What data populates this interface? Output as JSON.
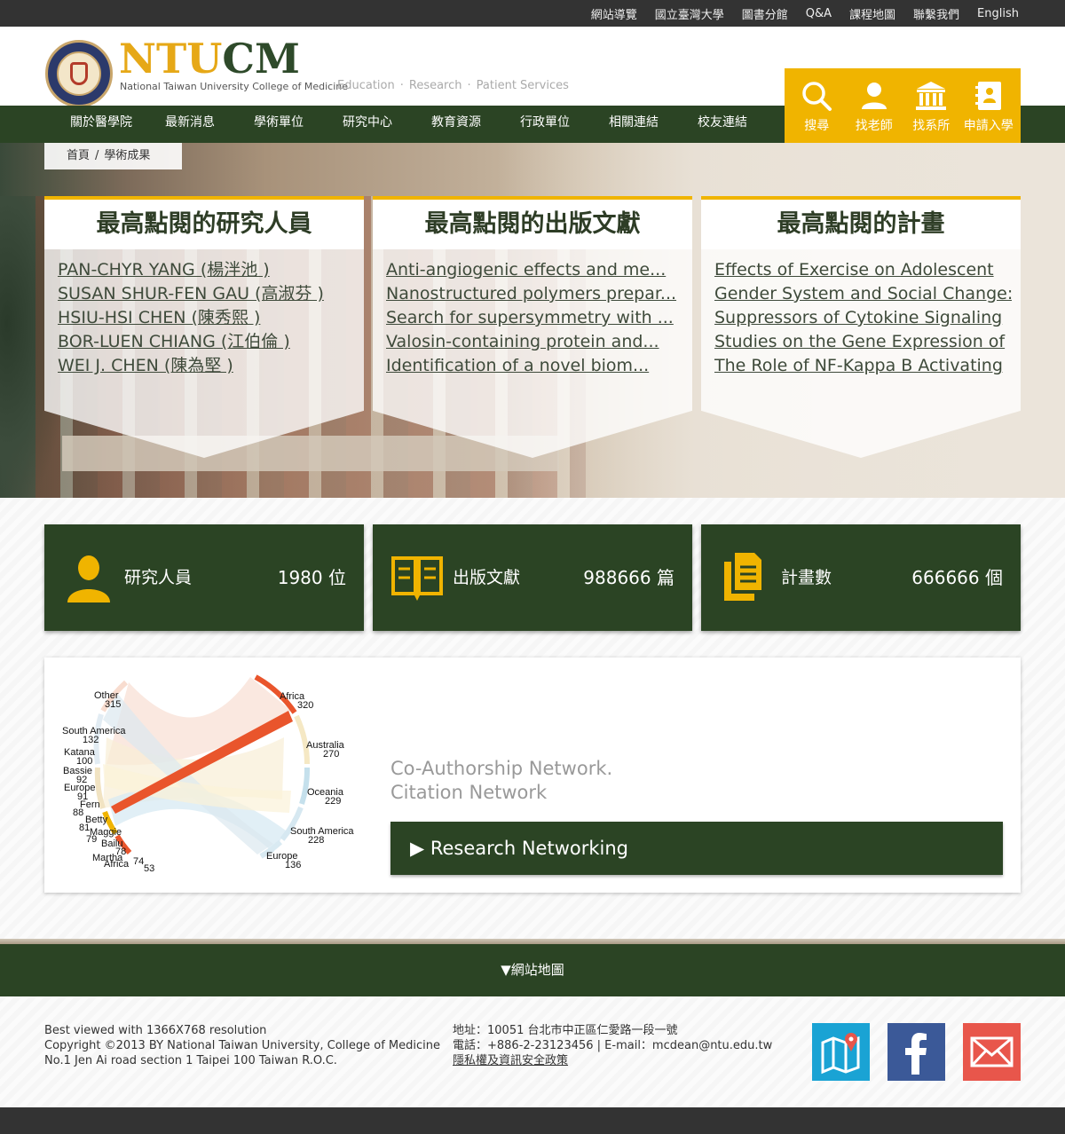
{
  "topbar": {
    "links": [
      "網站導覽",
      "國立臺灣大學",
      "圖書分館",
      "Q&A",
      "課程地圖",
      "聯繫我們",
      "English"
    ]
  },
  "header": {
    "brand_part1": "NTU",
    "brand_part2": "CM",
    "brand_sub": "National Taiwan University College of Medicine",
    "tagline": [
      "Education",
      "Research",
      "Patient Services"
    ]
  },
  "quick_links": [
    {
      "label": "搜尋",
      "icon": "search-icon"
    },
    {
      "label": "找老師",
      "icon": "user-icon"
    },
    {
      "label": "找系所",
      "icon": "institution-icon"
    },
    {
      "label": "申請入學",
      "icon": "address-book-icon"
    }
  ],
  "nav": [
    "關於醫學院",
    "最新消息",
    "學術單位",
    "研究中心",
    "教育資源",
    "行政單位",
    "相關連結",
    "校友連結"
  ],
  "breadcrumb": {
    "home": "首頁",
    "sep": "/",
    "current": "學術成果"
  },
  "cards": [
    {
      "title": "最高點閱的研究人員",
      "items": [
        "PAN-CHYR YANG (楊泮池 )",
        "SUSAN SHUR-FEN GAU (高淑芬 )",
        "HSIU-HSI CHEN (陳秀熙 )",
        "BOR-LUEN CHIANG (江伯倫 )",
        "WEI J. CHEN (陳為堅 )"
      ]
    },
    {
      "title": "最高點閱的出版文獻",
      "items": [
        "Anti-angiogenic effects and me...",
        "Nanostructured polymers prepar...",
        "Search for supersymmetry with ...",
        "Valosin-containing protein and...",
        "Identification of a novel biom..."
      ]
    },
    {
      "title": "最高點閱的計畫",
      "items": [
        "Effects of Exercise on Adolescent",
        "Gender System and Social Change:",
        "Suppressors of Cytokine Signaling",
        "Studies on the Gene Expression of",
        "The Role of NF-Kappa B Activating"
      ]
    }
  ],
  "stats": [
    {
      "label": "研究人員",
      "value": "1980 位",
      "icon": "person-icon"
    },
    {
      "label": "出版文獻",
      "value": "988666 篇",
      "icon": "book-icon"
    },
    {
      "label": "計畫數",
      "value": "666666 個",
      "icon": "documents-icon"
    }
  ],
  "network": {
    "text_line1": "Co-Authorship Network.",
    "text_line2": "Citation Network",
    "button_label": "▶ Research Networking",
    "chord_labels": [
      {
        "name": "Africa",
        "value": "320"
      },
      {
        "name": "Australia",
        "value": "270"
      },
      {
        "name": "Oceania",
        "value": "229"
      },
      {
        "name": "South America",
        "value": "228"
      },
      {
        "name": "Europe",
        "value": "136"
      },
      {
        "name": "Other",
        "value": "315"
      },
      {
        "name": "South America",
        "value": "132"
      },
      {
        "name": "Katana",
        "value": "100"
      },
      {
        "name": "Bassie",
        "value": "92"
      },
      {
        "name": "Europe",
        "value": "91"
      },
      {
        "name": "Fern",
        "value": "88"
      },
      {
        "name": "Betty",
        "value": "81"
      },
      {
        "name": "Maggie",
        "value": "79"
      },
      {
        "name": "Bailu",
        "value": "78"
      },
      {
        "name": "Martha",
        "value": "74"
      },
      {
        "name": "Africa",
        "value": "53"
      }
    ]
  },
  "footer": {
    "sitemap_label": "▼網站地圖",
    "left_lines": [
      "Best viewed with 1366X768 resolution",
      "Copyright ©2013 BY National Taiwan University, College of Medicine",
      "No.1 Jen Ai road section 1 Taipei 100 Taiwan R.O.C."
    ],
    "address": "地址：10051 台北市中正區仁愛路一段一號",
    "contact": "電話：+886-2-23123456 | E-mail：mcdean@ntu.edu.tw",
    "privacy_link": "隱私權及資訊安全政策"
  },
  "colors": {
    "accent": "#f0b400",
    "primary": "#2b4424",
    "map": "#1aa3d4",
    "facebook": "#3b5998",
    "mail": "#e8564b"
  }
}
